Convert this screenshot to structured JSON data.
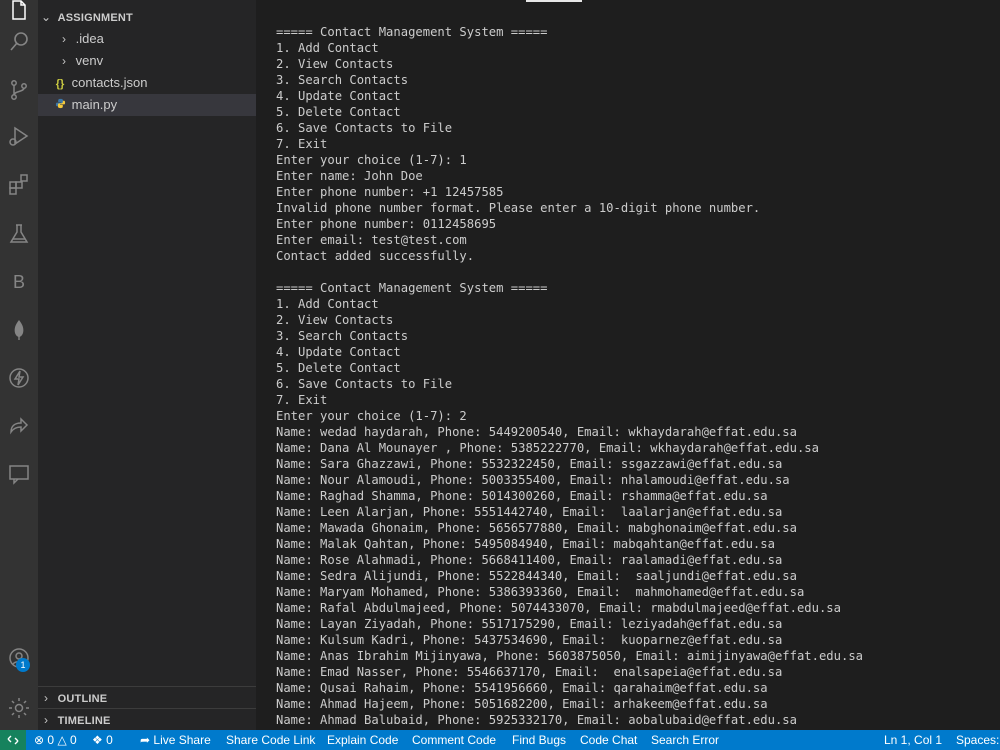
{
  "explorer": {
    "folder_name": "ASSIGNMENT",
    "items": [
      {
        "label": ".idea"
      },
      {
        "label": "venv"
      },
      {
        "label": "contacts.json"
      },
      {
        "label": "main.py"
      }
    ],
    "outline_label": "OUTLINE",
    "timeline_label": "TIMELINE"
  },
  "activity_bar": {
    "account_badge": "1",
    "b_label": "B"
  },
  "terminal": {
    "lines": [
      "===== Contact Management System =====",
      "1. Add Contact",
      "2. View Contacts",
      "3. Search Contacts",
      "4. Update Contact",
      "5. Delete Contact",
      "6. Save Contacts to File",
      "7. Exit",
      "Enter your choice (1-7): 1",
      "Enter name: John Doe",
      "Enter phone number: +1 12457585",
      "Invalid phone number format. Please enter a 10-digit phone number.",
      "Enter phone number: 0112458695",
      "Enter email: test@test.com",
      "Contact added successfully.",
      "",
      "===== Contact Management System =====",
      "1. Add Contact",
      "2. View Contacts",
      "3. Search Contacts",
      "4. Update Contact",
      "5. Delete Contact",
      "6. Save Contacts to File",
      "7. Exit",
      "Enter your choice (1-7): 2",
      "Name: wedad haydarah, Phone: 5449200540, Email: wkhaydarah@effat.edu.sa",
      "Name: Dana Al Mounayer , Phone: 5385222770, Email: wkhaydarah@effat.edu.sa",
      "Name: Sara Ghazzawi, Phone: 5532322450, Email: ssgazzawi@effat.edu.sa",
      "Name: Nour Alamoudi, Phone: 5003355400, Email: nhalamoudi@effat.edu.sa",
      "Name: Raghad Shamma, Phone: 5014300260, Email: rshamma@effat.edu.sa",
      "Name: Leen Alarjan, Phone: 5551442740, Email:  laalarjan@effat.edu.sa",
      "Name: Mawada Ghonaim, Phone: 5656577880, Email: mabghonaim@effat.edu.sa",
      "Name: Malak Qahtan, Phone: 5495084940, Email: mabqahtan@effat.edu.sa",
      "Name: Rose Alahmadi, Phone: 5668411400, Email: raalamadi@effat.edu.sa",
      "Name: Sedra Alijundi, Phone: 5522844340, Email:  saaljundi@effat.edu.sa",
      "Name: Maryam Mohamed, Phone: 5386393360, Email:  mahmohamed@effat.edu.sa",
      "Name: Rafal Abdulmajeed, Phone: 5074433070, Email: rmabdulmajeed@effat.edu.sa",
      "Name: Layan Ziyadah, Phone: 5517175290, Email: leziyadah@effat.edu.sa",
      "Name: Kulsum Kadri, Phone: 5437534690, Email:  kuoparnez@effat.edu.sa",
      "Name: Anas Ibrahim Mijinyawa, Phone: 5603875050, Email: aimijinyawa@effat.edu.sa",
      "Name: Emad Nasser, Phone: 5546637170, Email:  enalsapeia@effat.edu.sa",
      "Name: Qusai Rahaim, Phone: 5541956660, Email: qarahaim@effat.edu.sa",
      "Name: Ahmad Hajeem, Phone: 5051682200, Email: arhakeem@effat.edu.sa",
      "Name: Ahmad Balubaid, Phone: 5925332170, Email: aobalubaid@effat.edu.sa"
    ]
  },
  "status_bar": {
    "errors": "0",
    "warnings": "0",
    "ports": "0",
    "live_share": "Live Share",
    "share_code_link": "Share Code Link",
    "explain_code": "Explain Code",
    "comment_code": "Comment Code",
    "find_bugs": "Find Bugs",
    "code_chat": "Code Chat",
    "search_error": "Search Error",
    "cursor_position": "Ln 1, Col 1",
    "spaces": "Spaces:"
  },
  "colors": {
    "activity_bar": "#333333",
    "sidebar": "#252526",
    "editor": "#1e1e1e",
    "status_bar": "#007acc",
    "remote": "#16825d"
  }
}
